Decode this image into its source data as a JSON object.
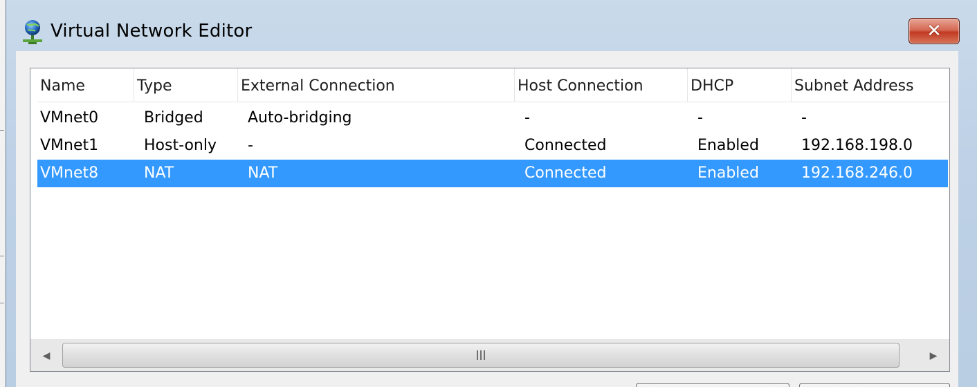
{
  "window": {
    "title": "Virtual Network Editor",
    "icon": "network-globe-icon",
    "close_symbol": "✕"
  },
  "list": {
    "columns": [
      "Name",
      "Type",
      "External Connection",
      "Host Connection",
      "DHCP",
      "Subnet Address"
    ],
    "rows": [
      {
        "name": "VMnet0",
        "type": "Bridged",
        "external": "Auto-bridging",
        "host": "-",
        "dhcp": "-",
        "subnet": "-"
      },
      {
        "name": "VMnet1",
        "type": "Host-only",
        "external": "-",
        "host": "Connected",
        "dhcp": "Enabled",
        "subnet": "192.168.198.0"
      },
      {
        "name": "VMnet8",
        "type": "NAT",
        "external": "NAT",
        "host": "Connected",
        "dhcp": "Enabled",
        "subnet": "192.168.246.0"
      }
    ],
    "selected_row": "VMnet8"
  },
  "scrollbar": {
    "left_arrow": "◀",
    "right_arrow": "▶"
  },
  "colors": {
    "selection": "#3399ff",
    "title_bar": "#bed1e6",
    "close_button": "#c23a22"
  }
}
